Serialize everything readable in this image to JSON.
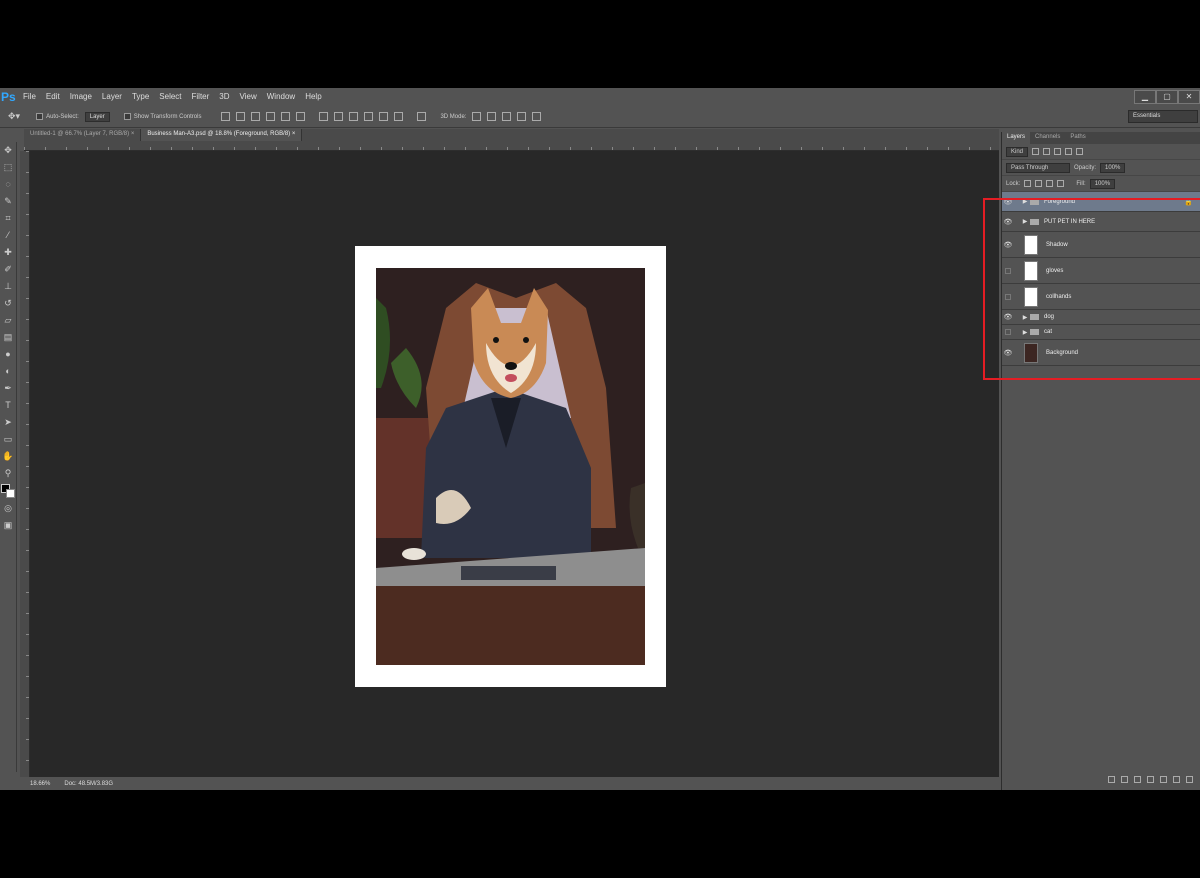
{
  "app": {
    "logo": "Ps"
  },
  "menu": [
    "File",
    "Edit",
    "Image",
    "Layer",
    "Type",
    "Select",
    "Filter",
    "3D",
    "View",
    "Window",
    "Help"
  ],
  "window_controls": [
    "▁",
    "▢",
    "✕"
  ],
  "options_bar": {
    "auto_select_label": "Auto-Select:",
    "auto_select_value": "Layer",
    "transform_controls_label": "Show Transform Controls",
    "mode_label": "3D Mode:"
  },
  "workspace": "Essentials",
  "tabs": [
    {
      "label": "Untitled-1 @ 66.7% (Layer 7, RGB/8)",
      "close": "×"
    },
    {
      "label": "Business Man-A3.psd @ 18.8% (Foreground, RGB/8)",
      "close": "×"
    }
  ],
  "status": {
    "zoom": "18.66%",
    "doc": "Doc: 48.5M/3.83G"
  },
  "panel": {
    "tabs": [
      "Layers",
      "Channels",
      "Paths"
    ],
    "kind_label": "Kind",
    "blend_mode": "Pass Through",
    "opacity_label": "Opacity:",
    "opacity_value": "100%",
    "lock_label": "Lock:",
    "fill_label": "Fill:",
    "fill_value": "100%"
  },
  "layers": [
    {
      "name": "Foreground",
      "type": "group",
      "visible": true,
      "locked": true,
      "active": true
    },
    {
      "name": "PUT PET IN HERE",
      "type": "group",
      "visible": true
    },
    {
      "name": "Shadow",
      "type": "layer",
      "visible": true
    },
    {
      "name": "gloves",
      "type": "layer",
      "visible": false
    },
    {
      "name": "collhands",
      "type": "layer",
      "visible": false
    },
    {
      "name": "dog",
      "type": "group",
      "visible": true
    },
    {
      "name": "cat",
      "type": "group",
      "visible": false
    },
    {
      "name": "Background",
      "type": "layer",
      "visible": true,
      "dark": true
    }
  ],
  "artwork": {
    "subject": "dog in business suit seated at desk"
  }
}
